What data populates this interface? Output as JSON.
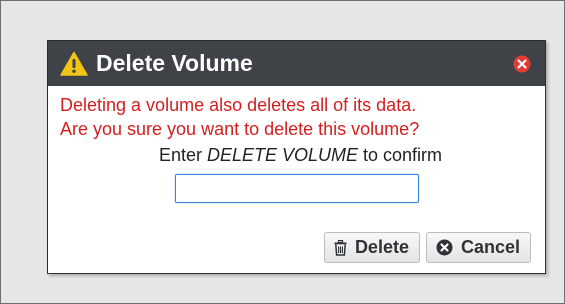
{
  "dialog": {
    "title": "Delete Volume",
    "message_line1": "Deleting a volume also deletes all of its data.",
    "message_line2": "Are you sure you want to delete this volume?",
    "confirm_prefix": "Enter ",
    "confirm_phrase": "DELETE VOLUME",
    "confirm_suffix": " to confirm",
    "input_value": "",
    "delete_label": "Delete",
    "cancel_label": "Cancel"
  },
  "icons": {
    "title": "warning-icon",
    "close": "close-icon",
    "delete": "trash-icon",
    "cancel": "cancel-icon"
  },
  "colors": {
    "title_bar": "#3f4348",
    "warning": "#f2c418",
    "close": "#e53935",
    "message": "#d51e1e",
    "input_focus": "#3a86d8"
  }
}
